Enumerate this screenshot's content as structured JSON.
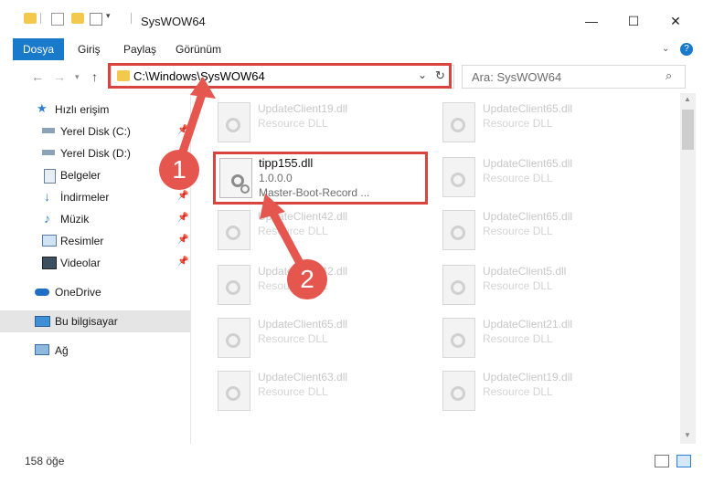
{
  "window": {
    "title": "SysWOW64"
  },
  "ribbon": {
    "tabs": [
      "Dosya",
      "Giriş",
      "Paylaş",
      "Görünüm"
    ]
  },
  "address": {
    "path": "C:\\Windows\\SysWOW64",
    "search_placeholder": "Ara: SysWOW64"
  },
  "sidebar": {
    "items": [
      {
        "label": "Hızlı erişim",
        "icon": "star-icon"
      },
      {
        "label": "Yerel Disk (C:)",
        "icon": "drive-icon",
        "pinned": true
      },
      {
        "label": "Yerel Disk (D:)",
        "icon": "drive-icon",
        "pinned": true
      },
      {
        "label": "Belgeler",
        "icon": "documents-icon",
        "pinned": true
      },
      {
        "label": "İndirmeler",
        "icon": "download-icon",
        "pinned": true
      },
      {
        "label": "Müzik",
        "icon": "music-icon",
        "pinned": true
      },
      {
        "label": "Resimler",
        "icon": "pictures-icon",
        "pinned": true
      },
      {
        "label": "Videolar",
        "icon": "video-icon",
        "pinned": true
      },
      {
        "label": "OneDrive",
        "icon": "cloud-icon"
      },
      {
        "label": "Bu bilgisayar",
        "icon": "computer-icon",
        "selected": true
      },
      {
        "label": "Ağ",
        "icon": "network-icon"
      }
    ]
  },
  "files": {
    "left": [
      {
        "name": "UpdateClient19.dll",
        "desc": "Resource DLL"
      },
      {
        "name": "UpdateClient42.dll",
        "desc": "Resource DLL"
      },
      {
        "name": "UpdateClient42.dll",
        "desc": "Resource DLL"
      },
      {
        "name": "UpdateClient65.dll",
        "desc": "Resource DLL"
      },
      {
        "name": "UpdateClient63.dll",
        "desc": "Resource DLL"
      }
    ],
    "right": [
      {
        "name": "UpdateClient65.dll",
        "desc": "Resource DLL"
      },
      {
        "name": "UpdateClient65.dll",
        "desc": "Resource DLL"
      },
      {
        "name": "UpdateClient65.dll",
        "desc": "Resource DLL"
      },
      {
        "name": "UpdateClient5.dll",
        "desc": "Resource DLL"
      },
      {
        "name": "UpdateClient21.dll",
        "desc": "Resource DLL"
      },
      {
        "name": "UpdateClient19.dll",
        "desc": "Resource DLL"
      }
    ],
    "highlighted": {
      "name": "tipp155.dll",
      "version": "1.0.0.0",
      "desc": "Master-Boot-Record ..."
    }
  },
  "status": {
    "count": "158 öğe"
  },
  "annotations": {
    "step1": "1",
    "step2": "2"
  },
  "colors": {
    "accent": "#1979ca",
    "highlight": "#d9453e"
  }
}
